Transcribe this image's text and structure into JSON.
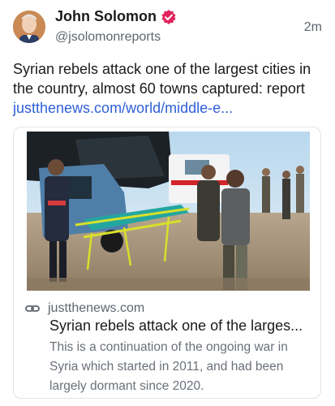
{
  "post": {
    "author_name": "John Solomon",
    "handle": "@jsolomonreports",
    "time": "2m",
    "text": "Syrian rebels attack one of the largest cities in the country, almost 60 towns captured: report ",
    "link_text": "justthenews.com/world/middle-e..."
  },
  "card": {
    "domain": "justthenews.com",
    "title": "Syrian rebels attack one of the larges...",
    "description": "This is a continuation of the ongoing war in Syria which started in 2011, and had been largely dormant since 2020."
  },
  "icons": {
    "verified": "verified-badge-icon",
    "link": "link-chain-icon"
  },
  "colors": {
    "link": "#2f5fd8",
    "verified": "#e0245e",
    "secondary_text": "#5f6670"
  }
}
